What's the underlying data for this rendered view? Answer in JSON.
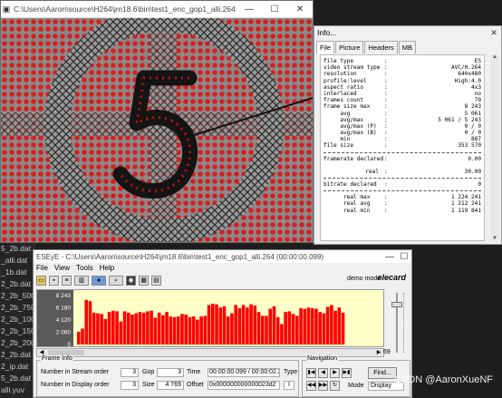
{
  "background_files": [
    "5_2b.dat",
    "_alli.dat",
    "_1b.dat",
    "2_2b.dat",
    "2_2b_500k",
    "2_2b_750k",
    "2_2b_100k",
    "2_2b_150k",
    "2_2b_2000",
    "2_2b.dat",
    "2_ip.dat",
    "5_2b.dat",
    "alli.yuv"
  ],
  "video_window": {
    "title": "C:\\Users\\Aaron\\source\\H264\\jm18.6\\bin\\test1_enc_gop1_alli.264",
    "digit": "5"
  },
  "info_window": {
    "title": "Info...",
    "tabs": [
      "File",
      "Picture",
      "Headers",
      "MB"
    ],
    "rows_a": [
      {
        "k": "file type",
        "v": "ES"
      },
      {
        "k": "video stream type",
        "v": "AVC/H.264"
      },
      {
        "k": "resolution",
        "v": "640x480"
      },
      {
        "k": "profile:level",
        "v": "High:4.0"
      },
      {
        "k": "aspect ratio",
        "v": "4x3"
      },
      {
        "k": "interlaced",
        "v": "no"
      },
      {
        "k": "frames count",
        "v": "70"
      },
      {
        "k": "frame size max",
        "v": "8 243"
      },
      {
        "k": "     avg",
        "v": "5 061"
      },
      {
        "k": "     avg/max",
        "v": "5 061 / 5 243"
      },
      {
        "k": "     avg/max (P)",
        "v": "0 / 0"
      },
      {
        "k": "     avg/max (B)",
        "v": "0 / 0"
      },
      {
        "k": "     min",
        "v": "887"
      },
      {
        "k": "file size",
        "v": "353 570"
      }
    ],
    "framerate_label": "framerate declared",
    "framerate_value": "0.00",
    "real_label": "real",
    "real_value": "30.00",
    "bitrate_label": "bitrate declared",
    "bitrate_value": "0",
    "rows_b": [
      {
        "k": "      real max",
        "v": "1 224 241"
      },
      {
        "k": "      real avg",
        "v": "1 212 241"
      },
      {
        "k": "      real min",
        "v": "1 119 841"
      }
    ]
  },
  "eseye": {
    "title": "ESEyE - C:\\Users\\Aaron\\source\\H264\\jm18.6\\bin\\test1_enc_gop1_alli.264 (00:00:00.099)",
    "menu": [
      "File",
      "View",
      "Tools",
      "Help"
    ],
    "demo_mode": "demo mode",
    "logo": "elecard",
    "scroll_end": "69",
    "frame_info": {
      "legend": "Frame Info",
      "stream_order_label": "Number in Stream order",
      "stream_order": "3",
      "display_order_label": "Number in Display order",
      "display_order": "3",
      "gop_label": "Gop",
      "gop": "3",
      "size_label": "Size",
      "size": "4 769",
      "time_label": "Time",
      "time": "00:00:00.099 / 00:00:02.299",
      "offset_label": "Offset",
      "offset": "0x000000000000023d2",
      "type_label": "Type",
      "type": "I"
    },
    "navigation": {
      "legend": "Navigation",
      "find_label": "Find...",
      "mode_label": "Mode",
      "mode_value": "Display"
    }
  },
  "chart_data": {
    "type": "bar",
    "y_ticks": [
      "8 243",
      "6 180",
      "4 120",
      "2 060",
      "0"
    ],
    "ylim": [
      0,
      8243
    ],
    "x_range": [
      0,
      69
    ],
    "values": [
      2000,
      2500,
      7000,
      6800,
      5000,
      4900,
      4800,
      4000,
      5100,
      5300,
      5200,
      3600,
      5200,
      5000,
      4700,
      4900,
      5100,
      5000,
      5200,
      5300,
      4200,
      5000,
      4600,
      5100,
      4400,
      4300,
      4400,
      4800,
      4700,
      4300,
      4400,
      3900,
      4400,
      4500,
      6200,
      6400,
      6300,
      5800,
      6000,
      4400,
      4900,
      6200,
      5700,
      6200,
      5800,
      6300,
      6100,
      5100,
      4500,
      4500,
      5600,
      6000,
      4300,
      3200,
      5100,
      5200,
      4800,
      4500,
      5700,
      5600,
      5800,
      5700,
      5600,
      5100,
      4900,
      5900,
      6200,
      5300,
      5800,
      5000
    ],
    "bar_color": "#ff0000",
    "background": "#ffffc8"
  },
  "watermark": "CSDN @AaronXueNF"
}
